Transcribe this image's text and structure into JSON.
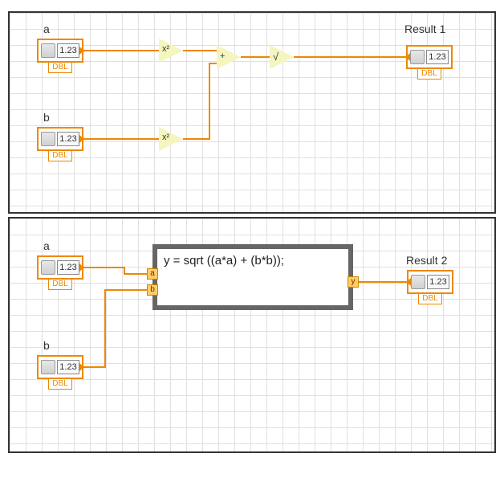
{
  "diagram1": {
    "input_a": {
      "label": "a",
      "display": "1.23",
      "datatype": "DBL"
    },
    "input_b": {
      "label": "b",
      "display": "1.23",
      "datatype": "DBL"
    },
    "op_square_a": "x²",
    "op_square_b": "x²",
    "op_add": "+",
    "op_sqrt": "√",
    "output": {
      "label": "Result 1",
      "display": "1.23",
      "datatype": "DBL"
    }
  },
  "diagram2": {
    "input_a": {
      "label": "a",
      "display": "1.23",
      "datatype": "DBL"
    },
    "input_b": {
      "label": "b",
      "display": "1.23",
      "datatype": "DBL"
    },
    "formula": {
      "expression": "y = sqrt ((a*a) + (b*b));",
      "tunnel_a": "a",
      "tunnel_b": "b",
      "tunnel_y": "y"
    },
    "output": {
      "label": "Result 2",
      "display": "1.23",
      "datatype": "DBL"
    }
  }
}
